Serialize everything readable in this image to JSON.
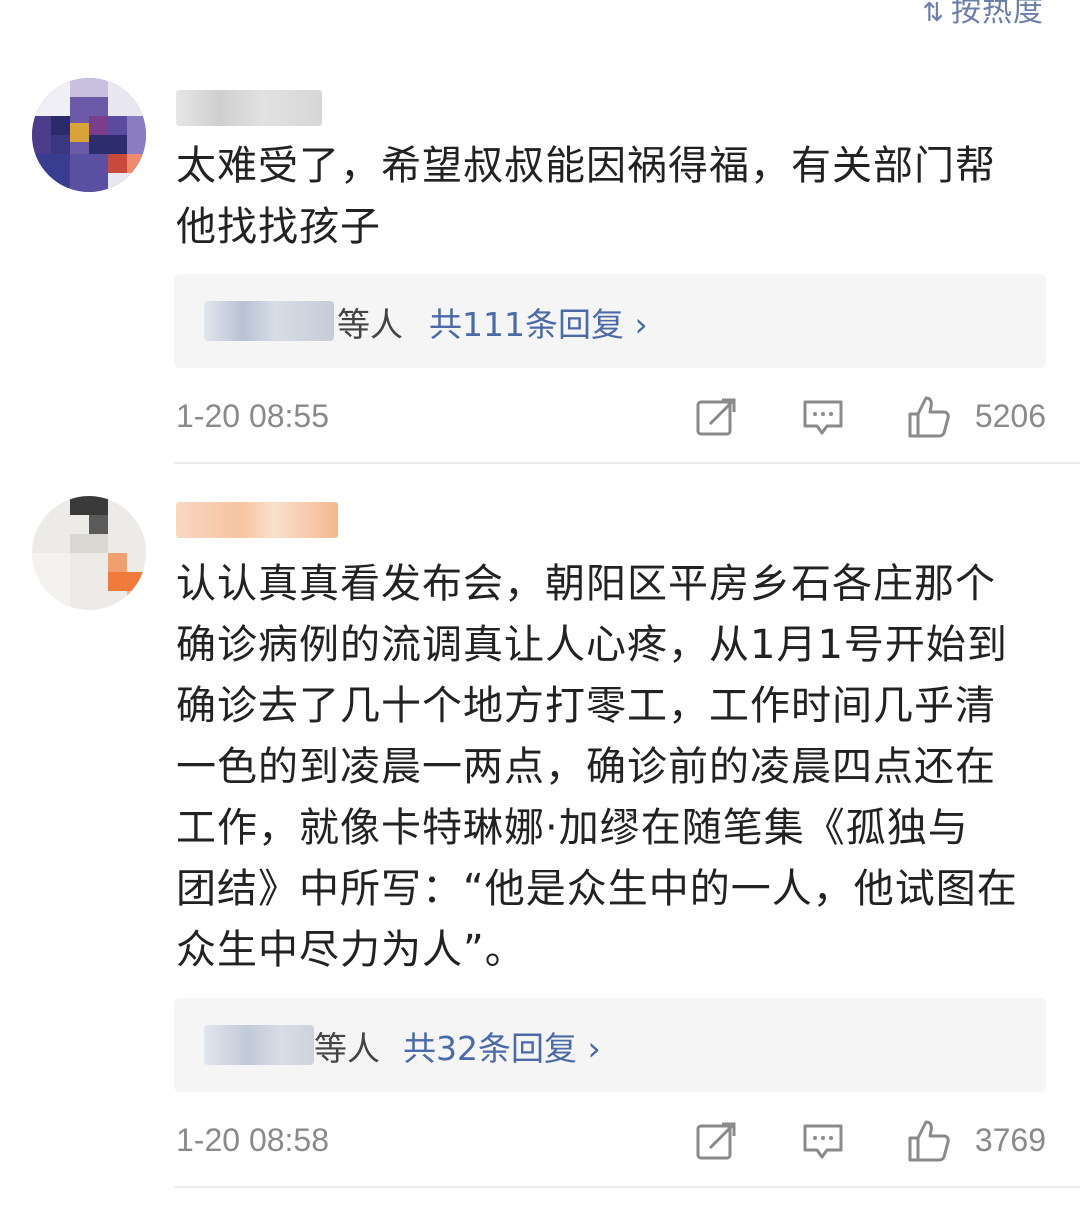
{
  "sort_toggle": {
    "label": "按热度",
    "icon": "sort-icon"
  },
  "comments": [
    {
      "text": "太难受了，希望叔叔能因祸得福，有关部门帮\n他找找孩子",
      "reply_others": "等人",
      "reply_count": "共111条回复 ›",
      "time": "1-20 08:55",
      "likes": "5206"
    },
    {
      "text": "认认真真看发布会，朝阳区平房乡石各庄那个\n确诊病例的流调真让人心疼，从1月1号开始到\n确诊去了几十个地方打零工，工作时间几乎清\n一色的到凌晨一两点，确诊前的凌晨四点还在\n工作，就像卡特琳娜·加缪在随笔集《孤独与\n团结》中所写：“他是众生中的一人，他试图在\n众生中尽力为人”。",
      "reply_others": "等人",
      "reply_count": "共32条回复 ›",
      "time": "1-20 08:58",
      "likes": "3769"
    }
  ],
  "icons": [
    "share-icon",
    "comment-icon",
    "like-icon"
  ],
  "colors": {
    "link": "#4a6aa8",
    "meta": "#8a8a8a",
    "reply_bg": "#f5f5f5",
    "text": "#222222"
  }
}
